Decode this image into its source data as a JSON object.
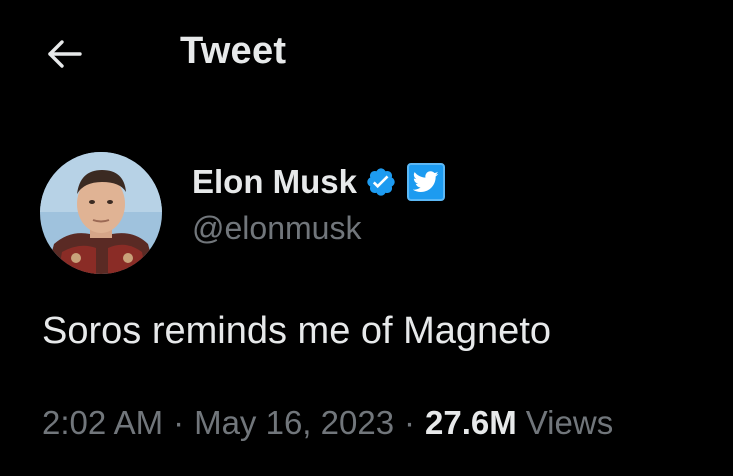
{
  "header": {
    "title": "Tweet",
    "back_icon": "arrow-left-icon"
  },
  "author": {
    "display_name": "Elon Musk",
    "handle": "@elonmusk",
    "verified_icon": "verified-badge-icon",
    "affiliate_icon": "twitter-bird-icon",
    "avatar": "profile-photo"
  },
  "tweet": {
    "text": "Soros reminds me of Magneto",
    "time": "2:02 AM",
    "separator": "·",
    "date": "May 16, 2023",
    "views_count": "27.6M",
    "views_label": "Views"
  },
  "colors": {
    "background": "#000000",
    "primary_text": "#e7e9ea",
    "secondary_text": "#71767b",
    "accent": "#1d9bf0"
  }
}
